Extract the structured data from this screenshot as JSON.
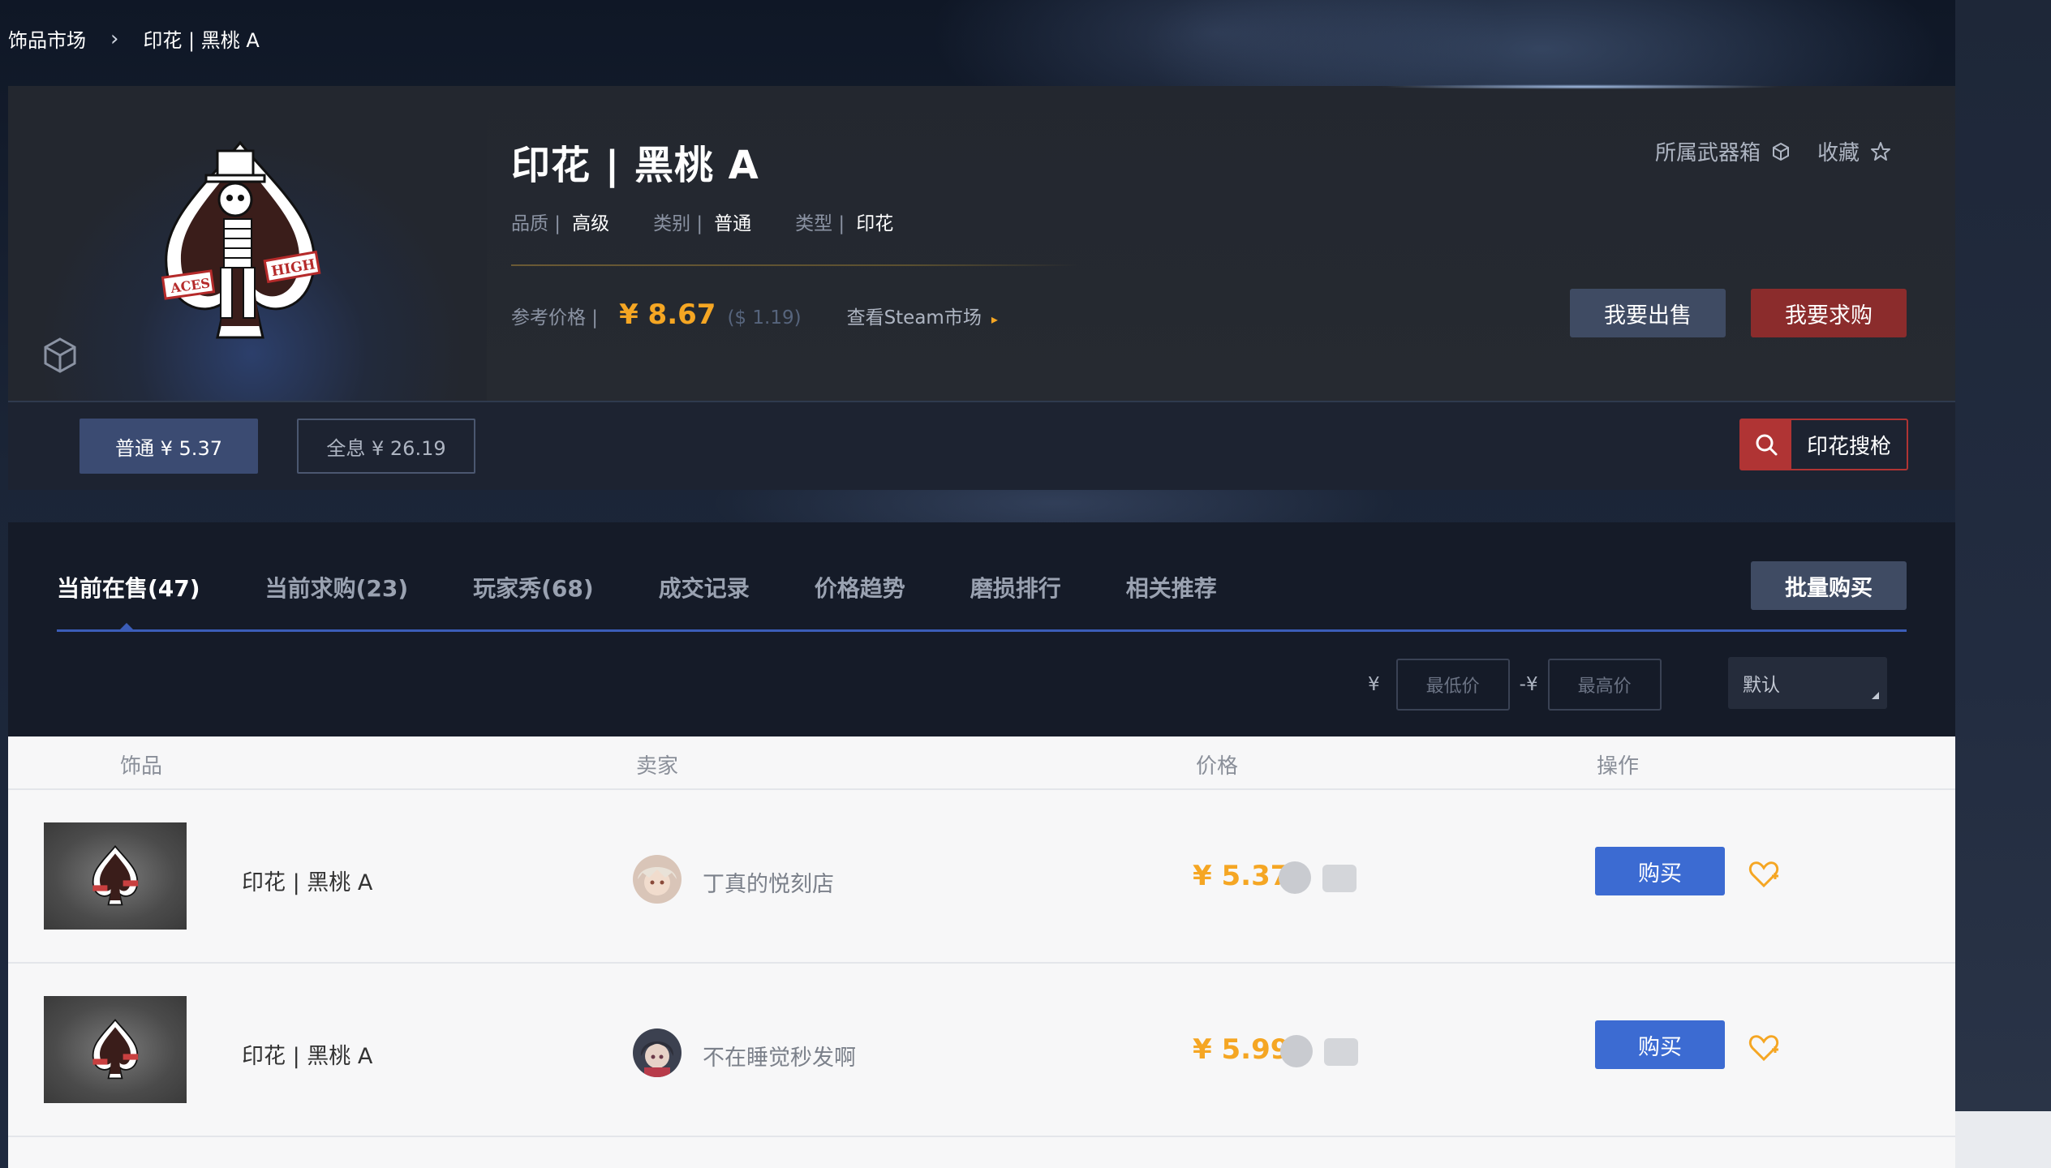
{
  "breadcrumb": {
    "root": "饰品市场",
    "current": "印花 | 黑桃 A"
  },
  "item": {
    "title": "印花 | 黑桃 A",
    "quality_label": "品质 |",
    "quality_value": "高级",
    "category_label": "类别 |",
    "category_value": "普通",
    "type_label": "类型 |",
    "type_value": "印花",
    "ref_price_label": "参考价格 |",
    "ref_price_cny": "¥ 8.67",
    "ref_price_usd": "($ 1.19)",
    "steam_link": "查看Steam市场"
  },
  "top_actions": {
    "weapon_case": "所属武器箱",
    "favorite": "收藏"
  },
  "buttons": {
    "sell": "我要出售",
    "buy_request": "我要求购",
    "batch_buy": "批量购买",
    "search_gun": "印花搜枪"
  },
  "variants": [
    {
      "label": "普通 ¥ 5.37",
      "active": true
    },
    {
      "label": "全息 ¥ 26.19",
      "active": false
    }
  ],
  "tabs": [
    {
      "label": "当前在售(47)",
      "active": true
    },
    {
      "label": "当前求购(23)"
    },
    {
      "label": "玩家秀(68)"
    },
    {
      "label": "成交记录"
    },
    {
      "label": "价格趋势"
    },
    {
      "label": "磨损排行"
    },
    {
      "label": "相关推荐"
    }
  ],
  "filter": {
    "currency1": "¥",
    "min_placeholder": "最低价",
    "currency2": "-¥",
    "max_placeholder": "最高价",
    "sort_value": "默认"
  },
  "table": {
    "headers": {
      "item": "饰品",
      "seller": "卖家",
      "price": "价格",
      "action": "操作"
    },
    "rows": [
      {
        "name": "印花 | 黑桃 A",
        "seller": "丁真的悦刻店",
        "price": "¥ 5.37",
        "buy": "购买"
      },
      {
        "name": "印花 | 黑桃 A",
        "seller": "不在睡觉秒发啊",
        "price": "¥ 5.99",
        "buy": "购买"
      }
    ]
  },
  "colors": {
    "accent_price": "#f5a623",
    "buy_blue": "#3c6bd2",
    "sell_red": "#8b2c2c",
    "tab_line": "#3b5db8"
  }
}
